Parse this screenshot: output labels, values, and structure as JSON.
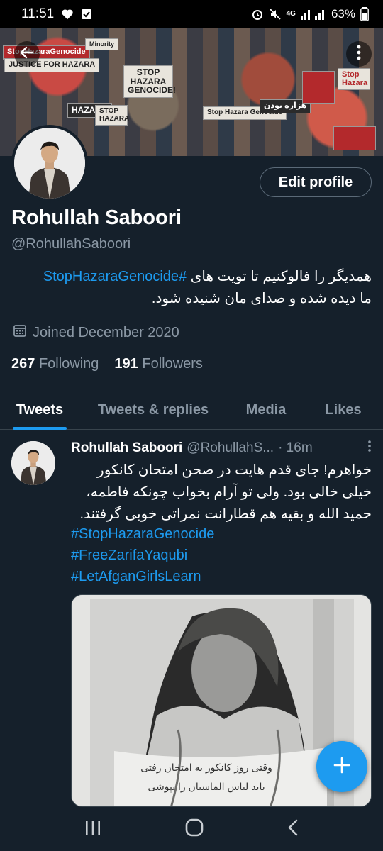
{
  "status_bar": {
    "time": "11:51",
    "network": "4G",
    "battery": "63%"
  },
  "banner": {
    "signs": [
      "StopHazaraGenocide",
      "JUSTICE FOR HAZARA",
      "STOP HAZARA GENOCIDE!",
      "HAZARA",
      "STOP HAZARA",
      "Stop Hazara Genocide",
      "هزاره بودن",
      "Minority",
      "Stop Hazara"
    ]
  },
  "profile": {
    "edit_label": "Edit profile",
    "name": "Rohullah Saboori",
    "handle": "@RohullahSaboori",
    "bio_hashtag": "#StopHazaraGenocide",
    "bio_text_1": "همدیگر را فالوکنیم تا تویت های",
    "bio_text_2": "ما دیده شده و صدای مان شنیده شود.",
    "joined": "Joined December 2020",
    "following_count": "267",
    "following_label": "Following",
    "followers_count": "191",
    "followers_label": "Followers"
  },
  "tabs": [
    {
      "label": "Tweets",
      "active": true
    },
    {
      "label": "Tweets & replies",
      "active": false
    },
    {
      "label": "Media",
      "active": false
    },
    {
      "label": "Likes",
      "active": false
    }
  ],
  "tweet": {
    "name": "Rohullah Saboori",
    "handle": "@RohullahS...",
    "time": "· 16m",
    "line1": "خواهرم! جای قدم هایت در صحن امتحان کانکور",
    "line2": "خیلی خالی بود. ولی تو آرام بخواب چونکه فاطمه،",
    "line3": "حمید الله و بقیه هم قطارانت نمراتی خوبی گرفتند.",
    "hashtags": [
      "#StopHazaraGenocide",
      "#FreeZarifaYaqubi",
      "#LetAfganGirlsLearn"
    ],
    "media_caption_1": "وقتی روز کانکور به امتحان رفتی",
    "media_caption_2": "باید لباس الماسیان را بپوشی"
  },
  "colors": {
    "background": "#15202b",
    "accent": "#1d9bf0",
    "secondary_text": "#8b98a5",
    "divider": "#38444d"
  },
  "icons": [
    "heart-icon",
    "check-square-icon",
    "alarm-icon",
    "mute-icon",
    "signal-icon",
    "battery-icon",
    "back-arrow-icon",
    "more-vertical-icon",
    "calendar-icon",
    "plus-icon",
    "recents-icon",
    "home-circle-icon",
    "back-chevron-icon"
  ]
}
